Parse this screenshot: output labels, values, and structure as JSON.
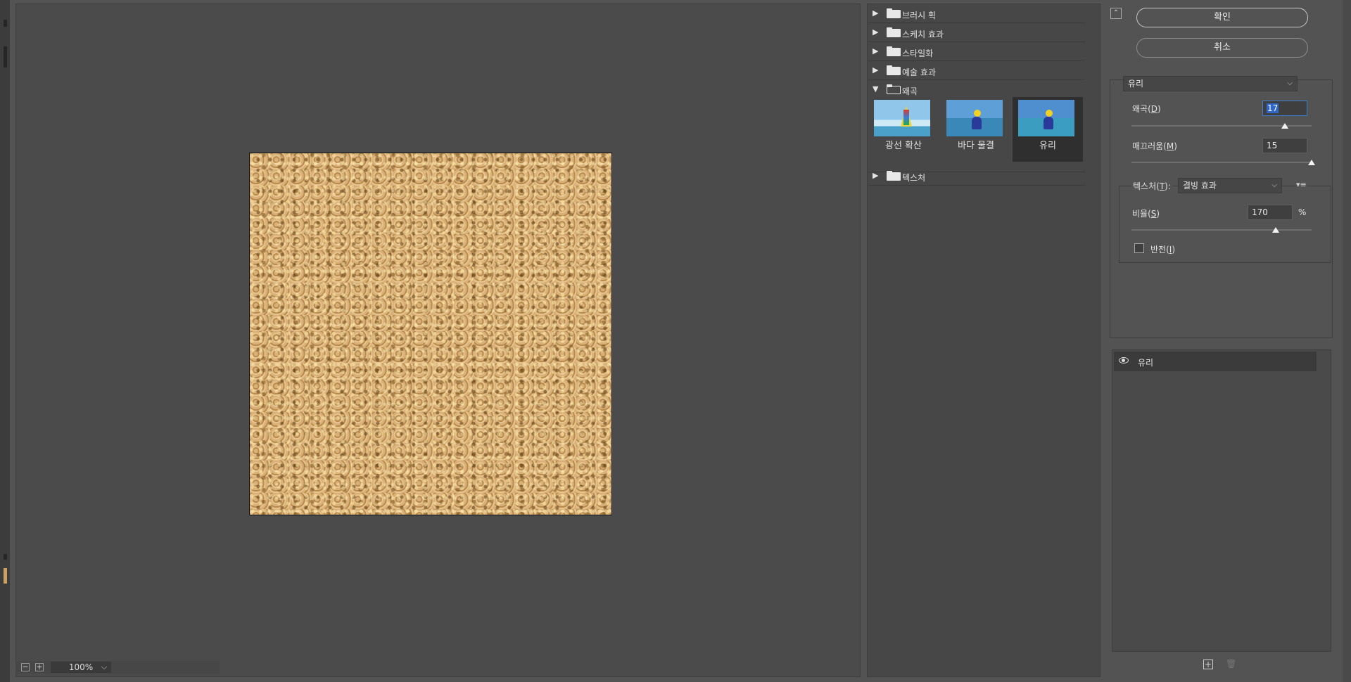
{
  "canvas": {
    "zoom": "100%"
  },
  "gallery": {
    "categories": [
      {
        "label": "브러시 획",
        "open": false
      },
      {
        "label": "스케치 효과",
        "open": false
      },
      {
        "label": "스타일화",
        "open": false
      },
      {
        "label": "예술 효과",
        "open": false
      },
      {
        "label": "왜곡",
        "open": true
      },
      {
        "label": "텍스처",
        "open": false
      }
    ],
    "distort_filters": [
      {
        "label": "광선 확산",
        "selected": false
      },
      {
        "label": "바다 물결",
        "selected": false
      },
      {
        "label": "유리",
        "selected": true
      }
    ]
  },
  "settings": {
    "ok_label": "확인",
    "cancel_label": "취소",
    "filter_select": "유리",
    "distortion": {
      "label": "왜곡",
      "mnemonic": "D",
      "value": "17",
      "max": 20
    },
    "smoothness": {
      "label": "매끄러움",
      "mnemonic": "M",
      "value": "15",
      "max": 15
    },
    "texture": {
      "label": "텍스처",
      "mnemonic": "T",
      "value": "결빙 효과"
    },
    "scaling": {
      "label": "비율",
      "mnemonic": "S",
      "value": "170",
      "unit": "%",
      "min": 50,
      "max": 200
    },
    "invert": {
      "label": "반전",
      "mnemonic": "I",
      "checked": false
    }
  },
  "layers": [
    {
      "name": "유리",
      "visible": true
    }
  ],
  "icons": {
    "collapse": "collapse-icon",
    "new_layer": "new-effect-layer-icon",
    "delete": "trash-icon",
    "eye": "eye-icon"
  }
}
